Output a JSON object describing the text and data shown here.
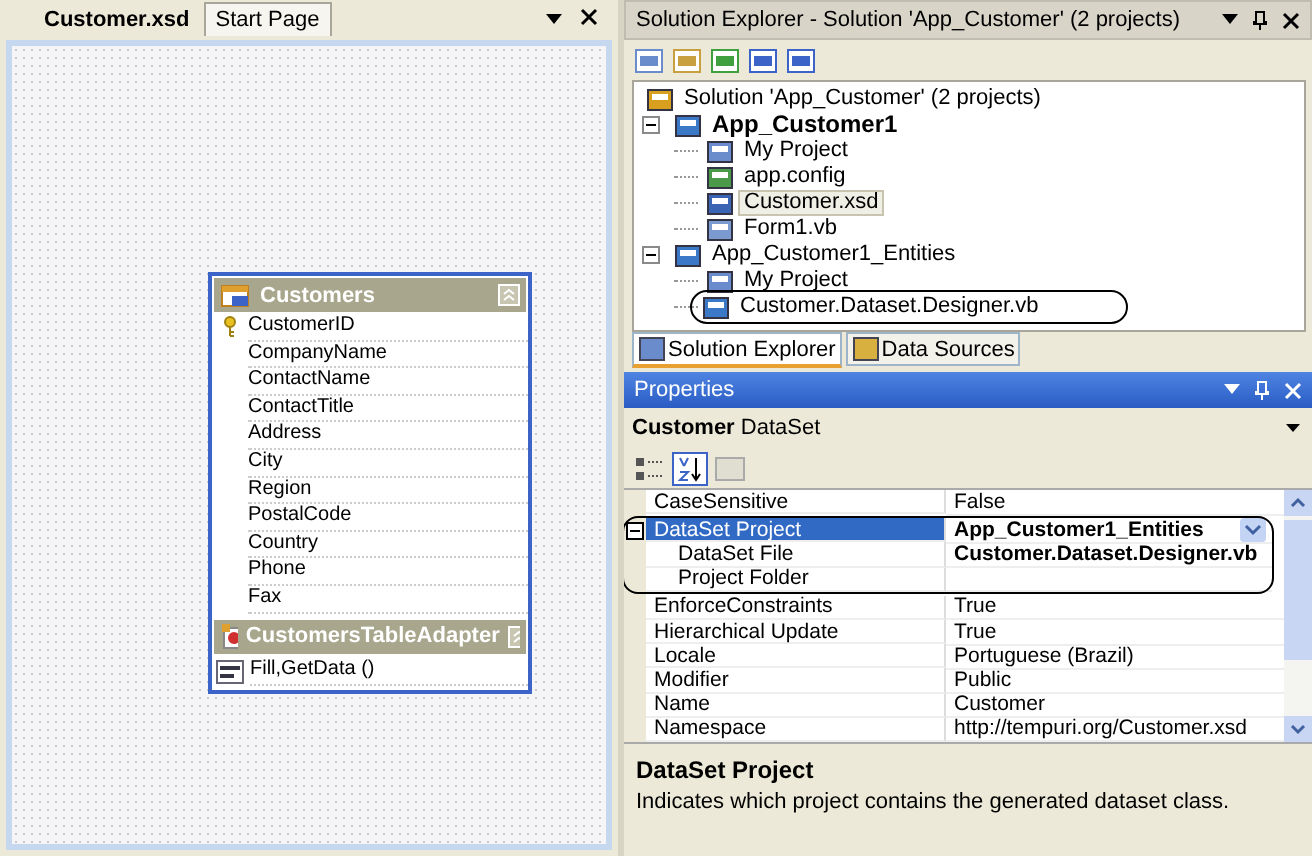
{
  "document_tabs": [
    {
      "label": "Customer.xsd",
      "selected": true
    },
    {
      "label": "Start Page",
      "selected": false
    }
  ],
  "designer": {
    "table": {
      "title": "Customers",
      "columns": [
        {
          "name": "CustomerID",
          "key": true
        },
        {
          "name": "CompanyName",
          "key": false
        },
        {
          "name": "ContactName",
          "key": false
        },
        {
          "name": "ContactTitle",
          "key": false
        },
        {
          "name": "Address",
          "key": false
        },
        {
          "name": "City",
          "key": false
        },
        {
          "name": "Region",
          "key": false
        },
        {
          "name": "PostalCode",
          "key": false
        },
        {
          "name": "Country",
          "key": false
        },
        {
          "name": "Phone",
          "key": false
        },
        {
          "name": "Fax",
          "key": false
        }
      ],
      "adapter": {
        "title": "CustomersTableAdapter",
        "methods": [
          "Fill,GetData ()"
        ]
      }
    }
  },
  "solution_explorer": {
    "title": "Solution Explorer - Solution 'App_Customer' (2 projects)",
    "tree": [
      {
        "label": "Solution 'App_Customer' (2 projects)",
        "kind": "solution",
        "startup": false,
        "selected": false,
        "children": [
          {
            "label": "App_Customer1",
            "kind": "project",
            "startup": true,
            "selected": false,
            "expanded": true,
            "children": [
              {
                "label": "My Project",
                "kind": "my-project",
                "startup": false,
                "selected": false
              },
              {
                "label": "app.config",
                "kind": "config",
                "startup": false,
                "selected": false
              },
              {
                "label": "Customer.xsd",
                "kind": "dataset",
                "startup": false,
                "selected": true
              },
              {
                "label": "Form1.vb",
                "kind": "form",
                "startup": false,
                "selected": false
              }
            ]
          },
          {
            "label": "App_Customer1_Entities",
            "kind": "project",
            "startup": false,
            "selected": false,
            "expanded": true,
            "children": [
              {
                "label": "My Project",
                "kind": "my-project",
                "startup": false,
                "selected": false
              },
              {
                "label": "Customer.Dataset.Designer.vb",
                "kind": "code",
                "startup": false,
                "selected": false,
                "circled": true
              }
            ]
          }
        ]
      }
    ]
  },
  "bottom_tabs": [
    {
      "label": "Solution Explorer",
      "selected": true
    },
    {
      "label": "Data Sources",
      "selected": false
    }
  ],
  "properties": {
    "title": "Properties",
    "object": {
      "name": "Customer",
      "type": "DataSet"
    },
    "rows": [
      {
        "name": "CaseSensitive",
        "value": "False",
        "modified": false,
        "selected": false
      },
      {
        "name": "DataSet Project",
        "value": "App_Customer1_Entities",
        "modified": true,
        "selected": true,
        "expanded": true,
        "circled": true,
        "children": [
          {
            "name": "DataSet File",
            "value": "Customer.Dataset.Designer.vb",
            "modified": true,
            "selected": false
          },
          {
            "name": "Project Folder",
            "selected": false
          }
        ]
      },
      {
        "name": "EnforceConstraints",
        "value": "True",
        "modified": false,
        "selected": false
      },
      {
        "name": "Hierarchical Update",
        "value": "True",
        "modified": false,
        "selected": false
      },
      {
        "name": "Locale",
        "value": "Portuguese (Brazil)",
        "modified": false,
        "selected": false
      },
      {
        "name": "Modifier",
        "value": "Public",
        "modified": false,
        "selected": false
      },
      {
        "name": "Name",
        "value": "Customer",
        "modified": false,
        "selected": false
      },
      {
        "name": "Namespace",
        "value": "http://tempuri.org/Customer.xsd",
        "modified": false,
        "selected": false
      }
    ],
    "description": {
      "title": "DataSet Project",
      "text": "Indicates which project contains the generated dataset class."
    }
  }
}
